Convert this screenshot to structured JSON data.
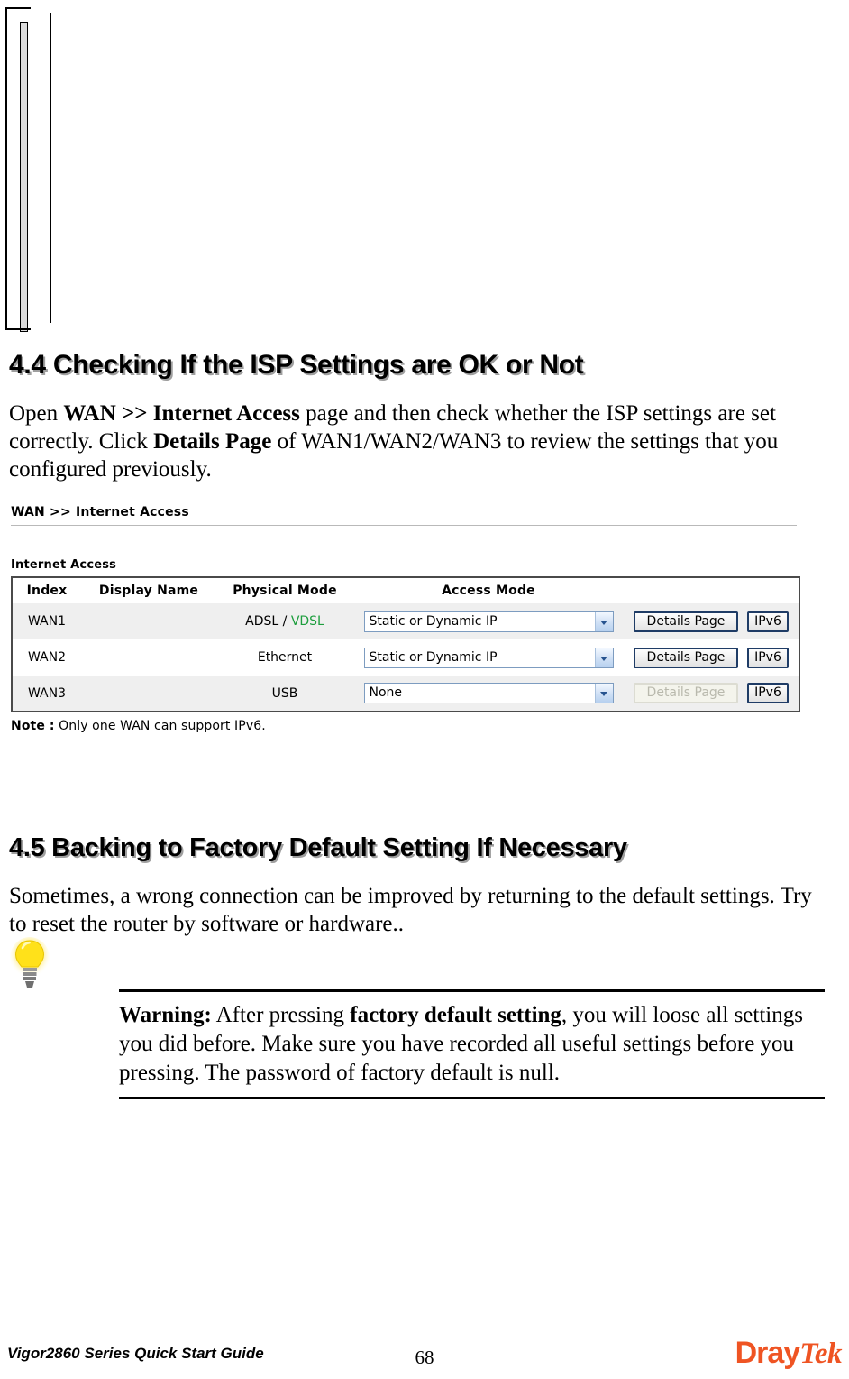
{
  "document": {
    "footer_title": "Vigor2860 Series Quick Start Guide",
    "page_number": "68",
    "logo": {
      "part1": "Dray",
      "part2": "Tek",
      "color": "#ef5423"
    }
  },
  "sections": {
    "s44": {
      "heading": "4.4 Checking If the ISP Settings are OK or Not",
      "paragraph": {
        "t1": "Open ",
        "b1": "WAN >> Internet Access",
        "t2": " page and then check whether the ISP settings are set correctly. Click ",
        "b2": "Details Page",
        "t3": " of WAN1/WAN2/WAN3 to review the settings that you configured previously."
      }
    },
    "s45": {
      "heading": "4.5 Backing to Factory Default Setting If Necessary",
      "paragraph": "Sometimes, a wrong connection can be improved by returning to the default settings. Try to reset the router by software or hardware.."
    }
  },
  "ui_screenshot": {
    "breadcrumb": "WAN >> Internet Access",
    "subtitle": "Internet Access",
    "columns": [
      "Index",
      "Display Name",
      "Physical Mode",
      "Access Mode"
    ],
    "rows": [
      {
        "index": "WAN1",
        "display_name": "",
        "physical_mode_plain": "ADSL / ",
        "physical_mode_green": "VDSL",
        "access_mode": "Static or Dynamic IP",
        "details_label": "Details Page",
        "details_disabled": false,
        "ipv6_label": "IPv6",
        "shaded": true
      },
      {
        "index": "WAN2",
        "display_name": "",
        "physical_mode_plain": "Ethernet",
        "physical_mode_green": "",
        "access_mode": "Static or Dynamic IP",
        "details_label": "Details Page",
        "details_disabled": false,
        "ipv6_label": "IPv6",
        "shaded": false
      },
      {
        "index": "WAN3",
        "display_name": "",
        "physical_mode_plain": "USB",
        "physical_mode_green": "",
        "access_mode": "None",
        "details_label": "Details Page",
        "details_disabled": true,
        "ipv6_label": "IPv6",
        "shaded": true
      }
    ],
    "note_label": "Note :",
    "note_text": " Only one WAN can support IPv6.",
    "colors": {
      "vdsl_green": "#1e9e3e",
      "row_shaded": "#efefef",
      "table_border": "#4a4a4a",
      "button_border": "#1f3c66"
    }
  },
  "warning": {
    "label": "Warning:",
    "t1": " After pressing ",
    "emphasis": "factory default setting",
    "t2": ", you will loose all settings you did before. Make sure you have recorded all useful settings before you pressing. The password of factory default is null."
  },
  "icons": {
    "lightbulb": "lightbulb-icon",
    "bulb_color": "#ffe11a",
    "bulb_base_color": "#8a8a8a"
  }
}
